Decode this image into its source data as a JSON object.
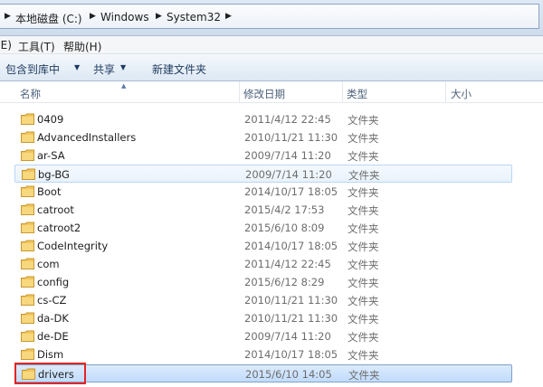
{
  "address": {
    "crumbs": [
      "本地磁盘 (C:)",
      "Windows",
      "System32"
    ]
  },
  "menu": {
    "items": [
      "(E)",
      "工具(T)",
      "帮助(H)"
    ]
  },
  "toolbar": {
    "include_library": "包含到库中",
    "share": "共享",
    "new_folder": "新建文件夹"
  },
  "columns": {
    "name": "名称",
    "modified": "修改日期",
    "type": "类型",
    "size": "大小"
  },
  "files": [
    {
      "name": "0409",
      "modified": "2011/4/12 22:45",
      "type": "文件夹"
    },
    {
      "name": "AdvancedInstallers",
      "modified": "2010/11/21 11:30",
      "type": "文件夹"
    },
    {
      "name": "ar-SA",
      "modified": "2009/7/14 11:20",
      "type": "文件夹"
    },
    {
      "name": "bg-BG",
      "modified": "2009/7/14 11:20",
      "type": "文件夹"
    },
    {
      "name": "Boot",
      "modified": "2014/10/17 18:05",
      "type": "文件夹"
    },
    {
      "name": "catroot",
      "modified": "2015/4/2 17:53",
      "type": "文件夹"
    },
    {
      "name": "catroot2",
      "modified": "2015/6/10 8:09",
      "type": "文件夹"
    },
    {
      "name": "CodeIntegrity",
      "modified": "2014/10/17 18:05",
      "type": "文件夹"
    },
    {
      "name": "com",
      "modified": "2011/4/12 22:45",
      "type": "文件夹"
    },
    {
      "name": "config",
      "modified": "2015/6/12 8:29",
      "type": "文件夹"
    },
    {
      "name": "cs-CZ",
      "modified": "2010/11/21 11:30",
      "type": "文件夹"
    },
    {
      "name": "da-DK",
      "modified": "2010/11/21 11:30",
      "type": "文件夹"
    },
    {
      "name": "de-DE",
      "modified": "2009/7/14 11:20",
      "type": "文件夹"
    },
    {
      "name": "Dism",
      "modified": "2014/10/17 18:05",
      "type": "文件夹"
    },
    {
      "name": "drivers",
      "modified": "2015/6/10 14:05",
      "type": "文件夹"
    }
  ],
  "colors": {
    "highlight": "#e52424",
    "selection": "#c1dcfc",
    "folder": "#f2c55c"
  }
}
